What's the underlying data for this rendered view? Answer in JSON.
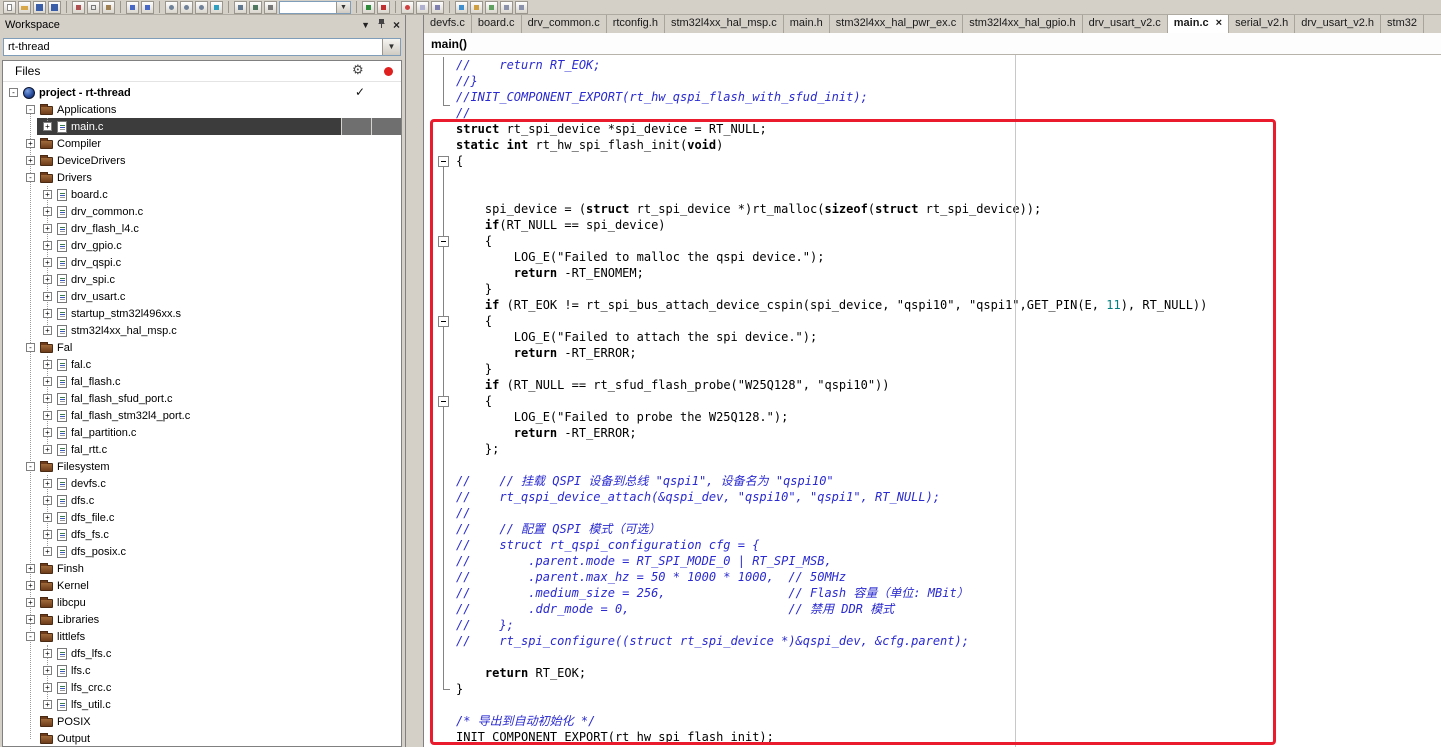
{
  "app": {
    "workspace_title": "Workspace",
    "glyphs": {
      "dropdown": "▼",
      "close": "×",
      "check": "✓",
      "gear": "⚙"
    }
  },
  "toolbar": {
    "items": [
      "new-file",
      "open-folder",
      "save",
      "save-all",
      "sep",
      "cut",
      "copy",
      "paste",
      "sep",
      "undo",
      "redo",
      "sep",
      "goto",
      "find",
      "find-in-files",
      "bookmark",
      "sep",
      "build",
      "rebuild",
      "batch-build",
      "combo",
      "sep",
      "flash-download",
      "debug",
      "sep",
      "breakpoint",
      "watch",
      "memory",
      "sep",
      "target",
      "trace",
      "pack",
      "options",
      "help"
    ]
  },
  "workspace": {
    "project_selector": "rt-thread",
    "files_header": "Files",
    "tree": [
      {
        "label": "project - rt-thread",
        "type": "project",
        "level": 0,
        "exp": "minus",
        "bold": true,
        "badge": "check"
      },
      {
        "label": "Applications",
        "type": "folder",
        "level": 1,
        "exp": "minus"
      },
      {
        "label": "main.c",
        "type": "file",
        "level": 2,
        "exp": "plus",
        "selected": true
      },
      {
        "label": "Compiler",
        "type": "folder",
        "level": 1,
        "exp": "plus"
      },
      {
        "label": "DeviceDrivers",
        "type": "folder",
        "level": 1,
        "exp": "plus"
      },
      {
        "label": "Drivers",
        "type": "folder",
        "level": 1,
        "exp": "minus"
      },
      {
        "label": "board.c",
        "type": "file",
        "level": 2,
        "exp": "plus"
      },
      {
        "label": "drv_common.c",
        "type": "file",
        "level": 2,
        "exp": "plus"
      },
      {
        "label": "drv_flash_l4.c",
        "type": "file",
        "level": 2,
        "exp": "plus"
      },
      {
        "label": "drv_gpio.c",
        "type": "file",
        "level": 2,
        "exp": "plus"
      },
      {
        "label": "drv_qspi.c",
        "type": "file",
        "level": 2,
        "exp": "plus"
      },
      {
        "label": "drv_spi.c",
        "type": "file",
        "level": 2,
        "exp": "plus"
      },
      {
        "label": "drv_usart.c",
        "type": "file",
        "level": 2,
        "exp": "plus"
      },
      {
        "label": "startup_stm32l496xx.s",
        "type": "file",
        "level": 2,
        "exp": "plus"
      },
      {
        "label": "stm32l4xx_hal_msp.c",
        "type": "file",
        "level": 2,
        "exp": "plus"
      },
      {
        "label": "Fal",
        "type": "folder",
        "level": 1,
        "exp": "minus"
      },
      {
        "label": "fal.c",
        "type": "file",
        "level": 2,
        "exp": "plus"
      },
      {
        "label": "fal_flash.c",
        "type": "file",
        "level": 2,
        "exp": "plus"
      },
      {
        "label": "fal_flash_sfud_port.c",
        "type": "file",
        "level": 2,
        "exp": "plus"
      },
      {
        "label": "fal_flash_stm32l4_port.c",
        "type": "file",
        "level": 2,
        "exp": "plus"
      },
      {
        "label": "fal_partition.c",
        "type": "file",
        "level": 2,
        "exp": "plus"
      },
      {
        "label": "fal_rtt.c",
        "type": "file",
        "level": 2,
        "exp": "plus"
      },
      {
        "label": "Filesystem",
        "type": "folder",
        "level": 1,
        "exp": "minus"
      },
      {
        "label": "devfs.c",
        "type": "file",
        "level": 2,
        "exp": "plus"
      },
      {
        "label": "dfs.c",
        "type": "file",
        "level": 2,
        "exp": "plus"
      },
      {
        "label": "dfs_file.c",
        "type": "file",
        "level": 2,
        "exp": "plus"
      },
      {
        "label": "dfs_fs.c",
        "type": "file",
        "level": 2,
        "exp": "plus"
      },
      {
        "label": "dfs_posix.c",
        "type": "file",
        "level": 2,
        "exp": "plus"
      },
      {
        "label": "Finsh",
        "type": "folder",
        "level": 1,
        "exp": "plus"
      },
      {
        "label": "Kernel",
        "type": "folder",
        "level": 1,
        "exp": "plus"
      },
      {
        "label": "libcpu",
        "type": "folder",
        "level": 1,
        "exp": "plus"
      },
      {
        "label": "Libraries",
        "type": "folder",
        "level": 1,
        "exp": "plus"
      },
      {
        "label": "littlefs",
        "type": "folder",
        "level": 1,
        "exp": "minus"
      },
      {
        "label": "dfs_lfs.c",
        "type": "file",
        "level": 2,
        "exp": "plus"
      },
      {
        "label": "lfs.c",
        "type": "file",
        "level": 2,
        "exp": "plus"
      },
      {
        "label": "lfs_crc.c",
        "type": "file",
        "level": 2,
        "exp": "plus"
      },
      {
        "label": "lfs_util.c",
        "type": "file",
        "level": 2,
        "exp": "plus"
      },
      {
        "label": "POSIX",
        "type": "folder",
        "level": 1,
        "exp": "none"
      },
      {
        "label": "Output",
        "type": "folder",
        "level": 1,
        "exp": "none"
      }
    ]
  },
  "editor": {
    "tabs": [
      {
        "label": "devfs.c"
      },
      {
        "label": "board.c"
      },
      {
        "label": "drv_common.c"
      },
      {
        "label": "rtconfig.h"
      },
      {
        "label": "stm32l4xx_hal_msp.c"
      },
      {
        "label": "main.h"
      },
      {
        "label": "stm32l4xx_hal_pwr_ex.c"
      },
      {
        "label": "stm32l4xx_hal_gpio.h"
      },
      {
        "label": "drv_usart_v2.c"
      },
      {
        "label": "main.c",
        "active": true,
        "close": "×"
      },
      {
        "label": "serial_v2.h"
      },
      {
        "label": "drv_usart_v2.h"
      },
      {
        "label": "stm32"
      }
    ],
    "context": "main()",
    "fold_lines": [
      7,
      12,
      17,
      22
    ],
    "code": [
      [
        {
          "t": "//    return RT_EOK;",
          "c": "cm"
        }
      ],
      [
        {
          "t": "//}",
          "c": "cm"
        }
      ],
      [
        {
          "t": "//INIT_COMPONENT_EXPORT(rt_hw_qspi_flash_with_sfud_init);",
          "c": "cm"
        }
      ],
      [
        {
          "t": "//",
          "c": "cm"
        }
      ],
      [
        {
          "t": "struct",
          "c": "kw"
        },
        {
          "t": " rt_spi_device *spi_device = RT_NULL;",
          "c": "pl"
        }
      ],
      [
        {
          "t": "static",
          "c": "kw"
        },
        {
          "t": " ",
          "c": "pl"
        },
        {
          "t": "int",
          "c": "kw"
        },
        {
          "t": " rt_hw_spi_flash_init(",
          "c": "pl"
        },
        {
          "t": "void",
          "c": "kw"
        },
        {
          "t": ")",
          "c": "pl"
        }
      ],
      [
        {
          "t": "{",
          "c": "pl"
        }
      ],
      [],
      [],
      [
        {
          "t": "    spi_device = (",
          "c": "pl"
        },
        {
          "t": "struct",
          "c": "kw"
        },
        {
          "t": " rt_spi_device *)rt_malloc(",
          "c": "pl"
        },
        {
          "t": "sizeof",
          "c": "kw"
        },
        {
          "t": "(",
          "c": "pl"
        },
        {
          "t": "struct",
          "c": "kw"
        },
        {
          "t": " rt_spi_device));",
          "c": "pl"
        }
      ],
      [
        {
          "t": "    ",
          "c": "pl"
        },
        {
          "t": "if",
          "c": "kw"
        },
        {
          "t": "(RT_NULL == spi_device)",
          "c": "pl"
        }
      ],
      [
        {
          "t": "    {",
          "c": "pl"
        }
      ],
      [
        {
          "t": "        LOG_E(\"Failed to malloc the qspi device.\");",
          "c": "pl"
        }
      ],
      [
        {
          "t": "        ",
          "c": "pl"
        },
        {
          "t": "return",
          "c": "kw"
        },
        {
          "t": " -RT_ENOMEM;",
          "c": "pl"
        }
      ],
      [
        {
          "t": "    }",
          "c": "pl"
        }
      ],
      [
        {
          "t": "    ",
          "c": "pl"
        },
        {
          "t": "if",
          "c": "kw"
        },
        {
          "t": " (RT_EOK != rt_spi_bus_attach_device_cspin(spi_device, \"qspi10\", \"qspi1\",GET_PIN(E, ",
          "c": "pl"
        },
        {
          "t": "11",
          "c": "num"
        },
        {
          "t": "), RT_NULL))",
          "c": "pl"
        }
      ],
      [
        {
          "t": "    {",
          "c": "pl"
        }
      ],
      [
        {
          "t": "        LOG_E(\"Failed to attach the spi device.\");",
          "c": "pl"
        }
      ],
      [
        {
          "t": "        ",
          "c": "pl"
        },
        {
          "t": "return",
          "c": "kw"
        },
        {
          "t": " -RT_ERROR;",
          "c": "pl"
        }
      ],
      [
        {
          "t": "    }",
          "c": "pl"
        }
      ],
      [
        {
          "t": "    ",
          "c": "pl"
        },
        {
          "t": "if",
          "c": "kw"
        },
        {
          "t": " (RT_NULL == rt_sfud_flash_probe(\"W25Q128\", \"qspi10\"))",
          "c": "pl"
        }
      ],
      [
        {
          "t": "    {",
          "c": "pl"
        }
      ],
      [
        {
          "t": "        LOG_E(\"Failed to probe the W25Q128.\");",
          "c": "pl"
        }
      ],
      [
        {
          "t": "        ",
          "c": "pl"
        },
        {
          "t": "return",
          "c": "kw"
        },
        {
          "t": " -RT_ERROR;",
          "c": "pl"
        }
      ],
      [
        {
          "t": "    };",
          "c": "pl"
        }
      ],
      [],
      [
        {
          "t": "//    // 挂载 QSPI 设备到总线 \"qspi1\", 设备名为 \"qspi10\"",
          "c": "cm"
        }
      ],
      [
        {
          "t": "//    rt_qspi_device_attach(&qspi_dev, \"qspi10\", \"qspi1\", RT_NULL);",
          "c": "cm"
        }
      ],
      [
        {
          "t": "//",
          "c": "cm"
        }
      ],
      [
        {
          "t": "//    // 配置 QSPI 模式（可选）",
          "c": "cm"
        }
      ],
      [
        {
          "t": "//    struct rt_qspi_configuration cfg = {",
          "c": "cm"
        }
      ],
      [
        {
          "t": "//        .parent.mode = RT_SPI_MODE_0 | RT_SPI_MSB,",
          "c": "cm"
        }
      ],
      [
        {
          "t": "//        .parent.max_hz = 50 * 1000 * 1000,  // 50MHz",
          "c": "cm"
        }
      ],
      [
        {
          "t": "//        .medium_size = 256,                 // Flash 容量（单位: MBit）",
          "c": "cm"
        }
      ],
      [
        {
          "t": "//        .ddr_mode = 0,                      // 禁用 DDR 模式",
          "c": "cm"
        }
      ],
      [
        {
          "t": "//    };",
          "c": "cm"
        }
      ],
      [
        {
          "t": "//    rt_spi_configure((struct rt_spi_device *)&qspi_dev, &cfg.parent);",
          "c": "cm"
        }
      ],
      [],
      [
        {
          "t": "    ",
          "c": "pl"
        },
        {
          "t": "return",
          "c": "kw"
        },
        {
          "t": " RT_EOK;",
          "c": "pl"
        }
      ],
      [
        {
          "t": "}",
          "c": "pl"
        }
      ],
      [],
      [
        {
          "t": "/* 导出到自动初始化 */",
          "c": "cm"
        }
      ],
      [
        {
          "t": "INIT_COMPONENT_EXPORT(rt_hw_spi_flash_init);",
          "c": "pl"
        }
      ]
    ]
  },
  "annotation": {
    "color": "#ea1b2d"
  }
}
